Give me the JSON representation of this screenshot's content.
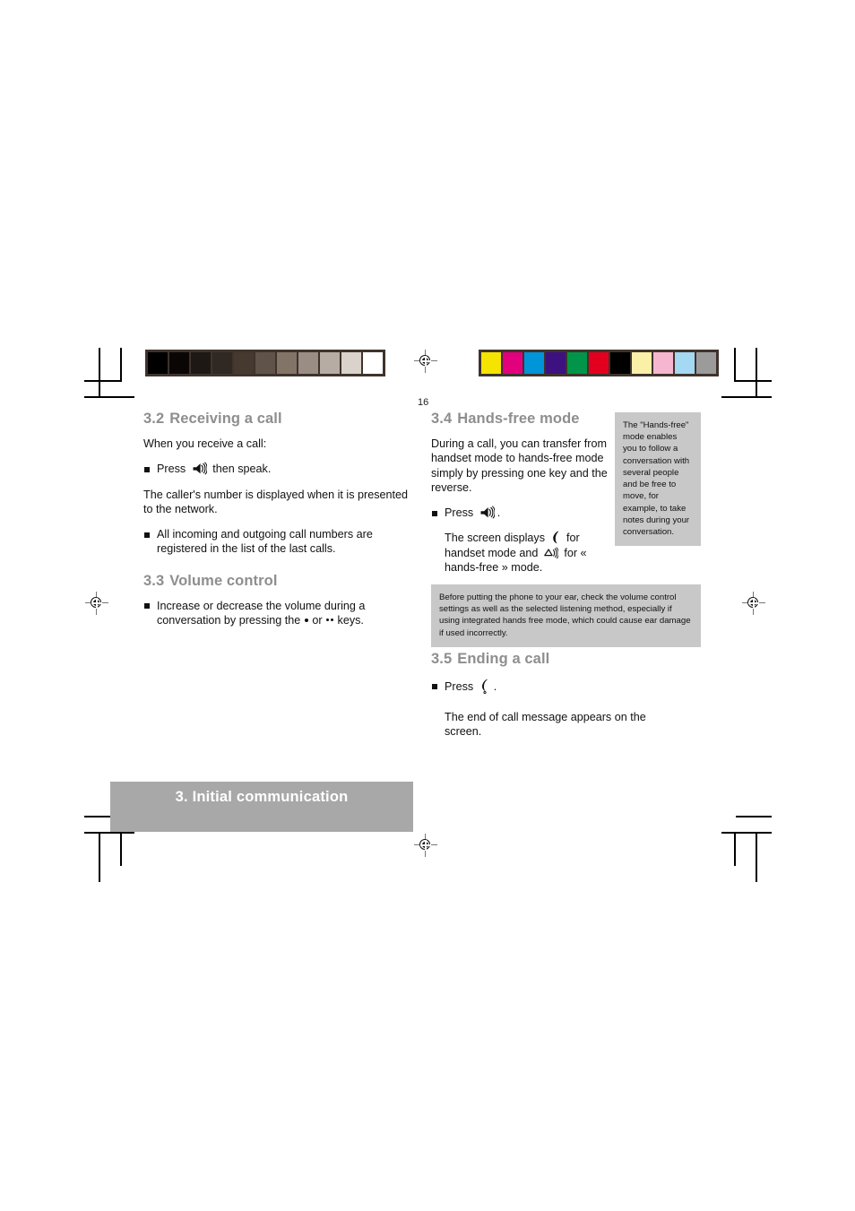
{
  "page": {
    "number": "16",
    "footer_banner": "3. Initial communication"
  },
  "calibration": {
    "gray_strip_label": "grayscale-calibration-strip",
    "gray_swatches": [
      "#000000",
      "#0a0605",
      "#1e1814",
      "#302823",
      "#46392f",
      "#605349",
      "#837468",
      "#9a8d84",
      "#b6aca4",
      "#d9d3cc",
      "#ffffff"
    ],
    "color_strip_label": "color-calibration-strip",
    "color_swatches": [
      "#f5e400",
      "#e2007d",
      "#0094d9",
      "#3d1180",
      "#009548",
      "#e3001f",
      "#000000",
      "#faf0a8",
      "#f7b6cf",
      "#a5d8f2",
      "#9b9b9b"
    ]
  },
  "left_column": {
    "section_32": {
      "number": "3.2",
      "title": "Receiving a call",
      "intro": "When you receive a call:",
      "bullet_press_prefix": "Press",
      "bullet_press_suffix": "then speak.",
      "caller_note": "The caller's number is displayed when it is presented to the network.",
      "bullet_registered": "All incoming and outgoing call numbers are registered in the list of the last calls."
    },
    "section_33": {
      "number": "3.3",
      "title": "Volume control",
      "bullet_volume_part1": "Increase or decrease the volume during a conversation by pressing the",
      "bullet_volume_or": "or",
      "bullet_volume_part2": "keys."
    }
  },
  "right_column": {
    "section_34": {
      "number": "3.4",
      "title": "Hands-free mode",
      "body": "During a call, you can transfer from handset mode to hands-free mode simply by pressing one key and the reverse.",
      "bullet_press_prefix": "Press",
      "bullet_press_suffix": ".",
      "screen_part1": "The screen displays",
      "screen_part2": "for handset mode and",
      "screen_part3": "for « hands-free » mode."
    },
    "section_35": {
      "number": "3.5",
      "title": "Ending a call",
      "bullet_press_prefix": "Press",
      "bullet_press_suffix": ".",
      "end_note": "The end of call message appears on the screen."
    }
  },
  "notes": {
    "side_note": "The \"Hands-free\" mode enables you to follow a conversation with several people and be free to move, for example, to take notes during your conversation.",
    "warning_note": "Before putting the phone to your ear, check the volume control settings as well as the selected listening method, especially if using integrated hands free mode, which could cause ear damage if used incorrectly."
  },
  "icons": {
    "speaker": "loudspeaker-icon",
    "handset": "handset-icon",
    "handsfree": "hands-free-icon",
    "endcall": "end-call-icon",
    "registration": "registration-target-icon"
  },
  "colors": {
    "heading_gray": "#8e8e8e",
    "note_box_gray": "#c8c8c8",
    "banner_gray": "#a8a8a8",
    "banner_text": "#ffffff",
    "body_text": "#111111"
  }
}
